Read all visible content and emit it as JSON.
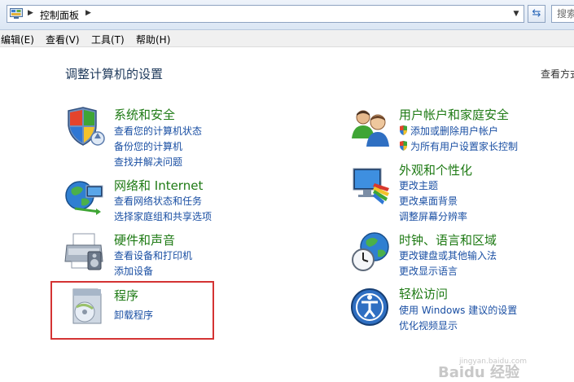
{
  "address_bar": {
    "breadcrumb": "控制面板",
    "search_placeholder": "搜索"
  },
  "menu": [
    {
      "label": "编辑(E)"
    },
    {
      "label": "查看(V)"
    },
    {
      "label": "工具(T)"
    },
    {
      "label": "帮助(H)"
    }
  ],
  "main": {
    "heading": "调整计算机的设置",
    "view_by": "查看方式",
    "categories": [
      {
        "title": "系统和安全",
        "icon": "security-shield-icon",
        "links": [
          "查看您的计算机状态",
          "备份您的计算机",
          "查找并解决问题"
        ]
      },
      {
        "title": "网络和 Internet",
        "icon": "network-globe-icon",
        "links": [
          "查看网络状态和任务",
          "选择家庭组和共享选项"
        ]
      },
      {
        "title": "硬件和声音",
        "icon": "printer-icon",
        "links": [
          "查看设备和打印机",
          "添加设备"
        ]
      },
      {
        "title": "程序",
        "icon": "programs-icon",
        "links": [
          "卸载程序"
        ]
      },
      {
        "title": "用户帐户和家庭安全",
        "icon": "users-icon",
        "links": [
          "添加或删除用户帐户",
          "为所有用户设置家长控制"
        ]
      },
      {
        "title": "外观和个性化",
        "icon": "monitor-palette-icon",
        "links": [
          "更改主题",
          "更改桌面背景",
          "调整屏幕分辨率"
        ]
      },
      {
        "title": "时钟、语言和区域",
        "icon": "clock-globe-icon",
        "links": [
          "更改键盘或其他输入法",
          "更改显示语言"
        ]
      },
      {
        "title": "轻松访问",
        "icon": "ease-of-access-icon",
        "links": [
          "使用 Windows 建议的设置",
          "优化视频显示"
        ]
      }
    ]
  },
  "watermark": {
    "brand": "Baidu 经验",
    "url": "jingyan.baidu.com"
  }
}
